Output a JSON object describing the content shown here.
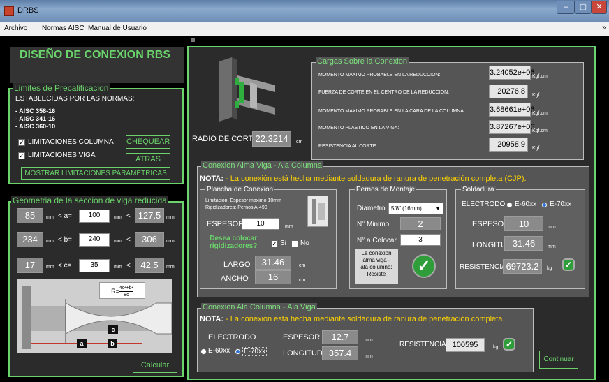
{
  "window": {
    "title": "DRBS",
    "min": "–",
    "max": "▢",
    "close": "✕"
  },
  "menu": {
    "items": [
      "Archivo",
      "Normas AISC",
      "Manual de Usuario"
    ]
  },
  "main_title": "DISEÑO DE CONEXION RBS",
  "limites": {
    "title": "Limites de Precalificacion",
    "subtitle": "ESTABLECIDAS POR LAS NORMAS:",
    "norms": [
      "- AISC 358-16",
      "- AISC 341-16",
      "- AISC 360-10"
    ],
    "chk_columna": "LIMITACIONES COLUMNA",
    "chk_viga": "LIMITACIONES VIGA",
    "btn_chequear": "CHEQUEAR",
    "btn_atras": "ATRAS",
    "btn_mostrar": "MOSTRAR LIMITACIONES PARAMETRICAS"
  },
  "geometria": {
    "title": "Geometria de la seccion de viga reducida",
    "rows": [
      {
        "min": "85",
        "label": "< a=",
        "value": "100",
        "max": "127.5"
      },
      {
        "min": "234",
        "label": "< b=",
        "value": "240",
        "max": "306"
      },
      {
        "min": "17",
        "label": "< c=",
        "value": "35",
        "max": "42.5"
      }
    ],
    "unit": "mm",
    "lt": "<",
    "formula": "R=",
    "formula_num": "4c²+b²",
    "formula_den": "8c",
    "labels": {
      "a": "a",
      "b": "b",
      "c": "c"
    },
    "btn_calcular": "Calcular"
  },
  "radio": {
    "label": "RADIO DE CORTE:",
    "value": "22.3214",
    "unit": "cm"
  },
  "cargas": {
    "title": "Cargas Sobre la Conexion",
    "rows": [
      {
        "label": "MOMENTO MAXIMO PROBABLE EN LA REDUCCION:",
        "value": "3.24052e+06",
        "unit": "Kgf.cm"
      },
      {
        "label": "FUERZA DE CORTE EN EL CENTRO DE LA REDUCCION:",
        "value": "20276.8",
        "unit": "Kgf"
      },
      {
        "label": "MOMENTO MAXIMO PROBABLE EN LA CARA DE LA COLUMNA:",
        "value": "3.68661e+06",
        "unit": "Kgf.cm"
      },
      {
        "label": "MOMENTO PLASTICO EN LA VIGA:",
        "value": "3.87267e+06",
        "unit": "Kgf.cm"
      },
      {
        "label": "RESISTENCIA AL CORTE:",
        "value": "20958.9",
        "unit": "Kgf"
      }
    ]
  },
  "alma": {
    "title": "Conexion Alma Viga - Ala Columna",
    "nota_label": "NOTA:",
    "nota": "- La conexión está hecha mediante soldadura de ranura de penetración completa (CJP).",
    "plancha": {
      "title": "Plancha de Conexion",
      "lim1": "Limitacion: Espesor maximo 10mm",
      "lim2": "Rigidizadores: Pernos A-490",
      "espesor_label": "ESPESOR",
      "espesor": "10",
      "unit_mm": "mm",
      "q1": "Desea colocar",
      "q2": "rigidizadores?",
      "si": "Si",
      "no": "No",
      "largo_label": "LARGO",
      "largo": "31.46",
      "ancho_label": "ANCHO",
      "ancho": "16",
      "unit_cm": "cm"
    },
    "pernos": {
      "title": "Pernos de Montaje",
      "diam_label": "Diametro",
      "diam": "5/8\" (16mm)",
      "min_label": "N° Minimo",
      "min": "2",
      "col_label": "N° a Colocar",
      "col": "3",
      "status": [
        "La conexion",
        "alma viga -",
        "ala columna:",
        "Resiste"
      ]
    },
    "soldadura": {
      "title": "Soldadura",
      "electrodo": "ELECTRODO",
      "e60": "E-60xx",
      "e70": "E-70xx",
      "espesor_label": "ESPESOR",
      "espesor": "10",
      "long_label": "LONGITUD",
      "longitud": "31.46",
      "res_label": "RESISTENCIA",
      "res": "69723.2",
      "unit_mm": "mm",
      "unit_kg": "kg"
    }
  },
  "ala": {
    "title": "Conexion Ala Columna - Ala Viga",
    "nota_label": "NOTA:",
    "nota": "- La conexión está hecha mediante soldadura de ranura de penetración completa.",
    "electrodo": "ELECTRODO",
    "e60": "E-60xx",
    "e70": "E-70xx",
    "espesor_label": "ESPESOR",
    "espesor": "12.7",
    "long_label": "LONGITUD",
    "longitud": "357.4",
    "unit_mm": "mm",
    "res_label": "RESISTENCIA",
    "res": "100595",
    "unit_kg": "kg",
    "btn_continuar": "Continuar"
  }
}
